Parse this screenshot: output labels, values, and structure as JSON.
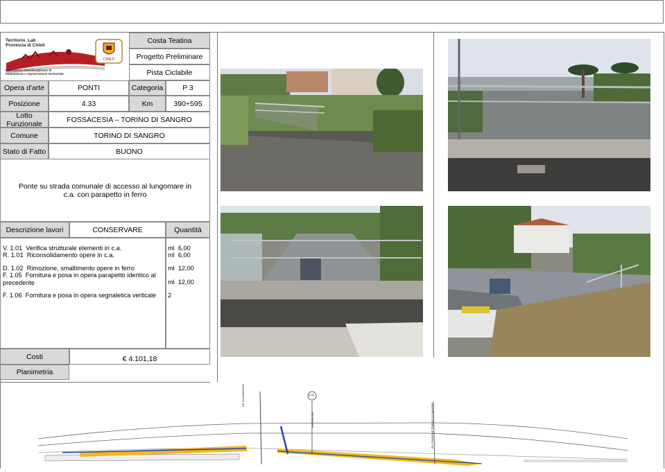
{
  "header": {
    "logo_line1": "Territorio_Lab",
    "logo_line2": "Provincia di Chieti",
    "logo_caption_line1": "Laboratorio interdisciplinare di",
    "logo_caption_line2": "innovazione e rigenerazione territoriale",
    "logo_emblem_label": "CHIETI",
    "project_area": "Costa Teatina",
    "project_phase": "Progetto Preliminare",
    "project_type": "Pista Ciclabile"
  },
  "info": {
    "opera_label": "Opera d'arte",
    "opera_value": "PONTI",
    "categoria_label": "Categoria",
    "categoria_value": "P 3",
    "posizione_label": "Posizione",
    "posizione_value": "4.33",
    "km_label": "Km",
    "km_value": "390+595",
    "lotto_label": "Lotto Funzionale",
    "lotto_value": "FOSSACESIA – TORINO DI SANGRO",
    "comune_label": "Comune",
    "comune_value": "TORINO DI SANGRO",
    "stato_label": "Stato di Fatto",
    "stato_value": "BUONO"
  },
  "description": "Ponte su strada  comunale di accesso al lungomare in c.a. con parapetto in ferro",
  "works": {
    "col_descrizione": "Descrizione lavori",
    "col_azione": "CONSERVARE",
    "col_quantita": "Quantità",
    "items": [
      {
        "code": "V. 1.01",
        "text": "Verifica strutturale elementi in c.a.",
        "unit": "ml",
        "qty": "6,00"
      },
      {
        "code": "R. 1.01",
        "text": "Riconsolidamento opere in c.a.",
        "unit": "ml",
        "qty": "6,00"
      },
      {
        "code": "D. 1.02",
        "text": "Rimozione, smaltimento opere in ferro",
        "unit": "ml",
        "qty": "12,00"
      },
      {
        "code": "F. 1.05",
        "text": "Fornitura e posa in opera parapetto identico al precedente",
        "unit": "ml",
        "qty": "12,00"
      },
      {
        "code": "F. 1.06",
        "text": "Fornitura e posa in opera segnaletica verticale",
        "unit": "",
        "qty": "2"
      }
    ]
  },
  "costs": {
    "costi_label": "Costi",
    "costi_value": "€ 4.101,18",
    "planimetria_label": "Planimetria"
  },
  "plan": {
    "marker": "4.33",
    "label_left": "SS 16 ADRIATICA",
    "label_mid": "KM 390+595",
    "label_right": "EX STAZIONE TORINO DI SANGRO",
    "colors": {
      "yellow": "#f2b71d",
      "blue": "#1c43b8"
    }
  }
}
